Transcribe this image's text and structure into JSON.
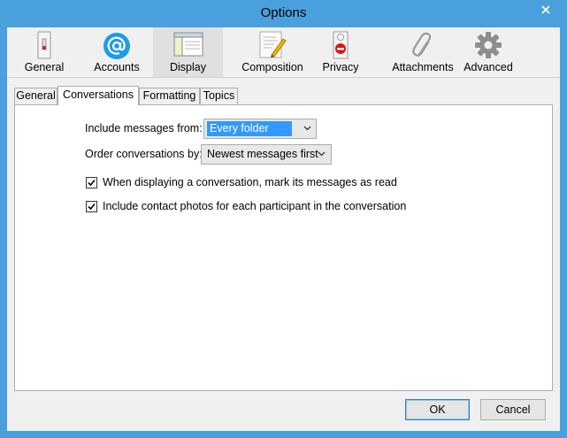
{
  "window": {
    "title": "Options"
  },
  "toolbar": {
    "items": [
      {
        "label": "General",
        "icon": "switch-icon"
      },
      {
        "label": "Accounts",
        "icon": "at-sign-icon"
      },
      {
        "label": "Display",
        "icon": "display-window-icon",
        "selected": true
      },
      {
        "label": "Composition",
        "icon": "pen-paper-icon"
      },
      {
        "label": "Privacy",
        "icon": "door-hanger-icon"
      },
      {
        "label": "Attachments",
        "icon": "paperclip-icon"
      },
      {
        "label": "Advanced",
        "icon": "gear-icon"
      }
    ]
  },
  "tabs": [
    {
      "label": "General"
    },
    {
      "label": "Conversations",
      "active": true
    },
    {
      "label": "Formatting"
    },
    {
      "label": "Topics"
    }
  ],
  "conversations": {
    "include_label": "Include messages from:",
    "include_value": "Every folder",
    "order_label": "Order conversations by:",
    "order_value": "Newest messages first",
    "mark_read_label": "When displaying a conversation, mark its messages as read",
    "mark_read_checked": true,
    "photos_label": "Include contact photos for each participant in the conversation",
    "photos_checked": true
  },
  "buttons": {
    "ok": "OK",
    "cancel": "Cancel"
  },
  "colors": {
    "titlebar": "#4aa0dc",
    "accent": "#3399ff",
    "close": "#c7c7c7"
  }
}
